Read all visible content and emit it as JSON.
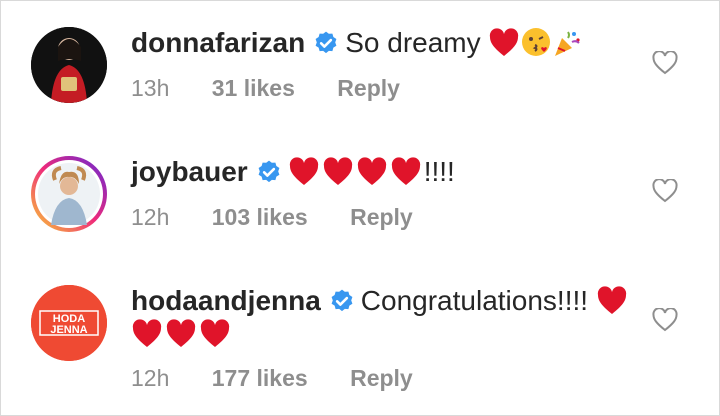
{
  "comments": [
    {
      "username": "donnafarizan",
      "text": "So dreamy",
      "time": "13h",
      "likes": "31 likes",
      "reply": "Reply"
    },
    {
      "username": "joybauer",
      "text": "!!!!",
      "time": "12h",
      "likes": "103 likes",
      "reply": "Reply"
    },
    {
      "username": "hodaandjenna",
      "text": "Congratulations!!!!",
      "time": "12h",
      "likes": "177 likes",
      "reply": "Reply",
      "avatar_text_top": "HODA",
      "avatar_text_bottom": "JENNA"
    }
  ],
  "colors": {
    "verified": "#3897f0",
    "heart": "#e0142a",
    "meta": "#8e8e8e",
    "text": "#262626",
    "hoda_avatar_bg": "#ef4a33"
  },
  "icons": [
    "verified-badge-icon",
    "red-heart-emoji",
    "kissing-face-emoji",
    "party-popper-emoji",
    "heart-outline-icon"
  ]
}
